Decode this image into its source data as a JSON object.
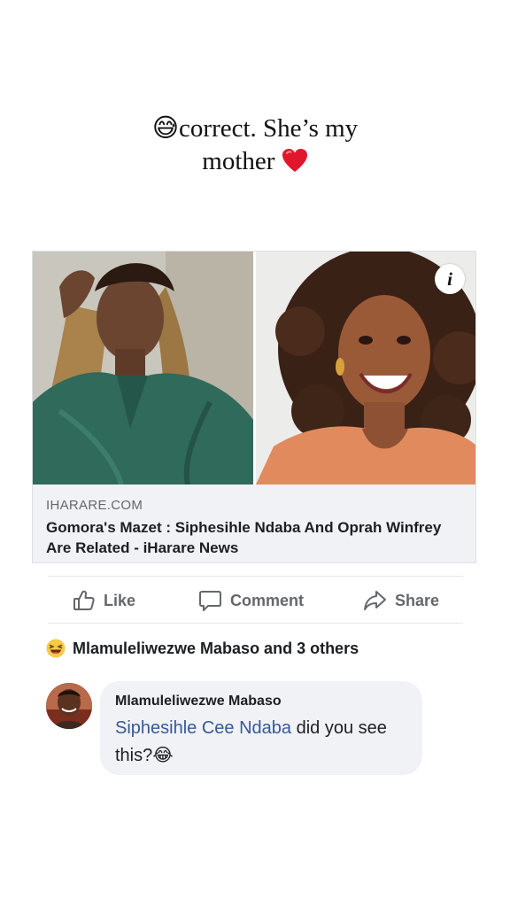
{
  "story": {
    "caption_emoji": "😅",
    "caption_line1": "correct. She’s my",
    "caption_line2": "mother",
    "caption_heart": "❤️"
  },
  "link_preview": {
    "domain": "IHARARE.COM",
    "headline": "Gomora's Mazet : Siphesihle Ndaba And Oprah Winfrey Are Related - iHarare News",
    "info_badge": "i"
  },
  "actions": {
    "like_label": "Like",
    "comment_label": "Comment",
    "share_label": "Share"
  },
  "reactions": {
    "icon": "laughing-emoji-icon",
    "summary": "Mlamuleliwezwe Mabaso and 3 others"
  },
  "comment": {
    "author": "Mlamuleliwezwe Mabaso",
    "mention": "Siphesihle Cee Ndaba",
    "text_after_mention": " did you see",
    "text_line2": "this?",
    "trailing_emoji": "😂"
  },
  "colors": {
    "meta_background": "#f0f2f5",
    "muted_text": "#65676b",
    "mention_blue": "#385898",
    "left_photo_green": "#2f6a5a",
    "right_photo_orange": "#e08a5e"
  }
}
